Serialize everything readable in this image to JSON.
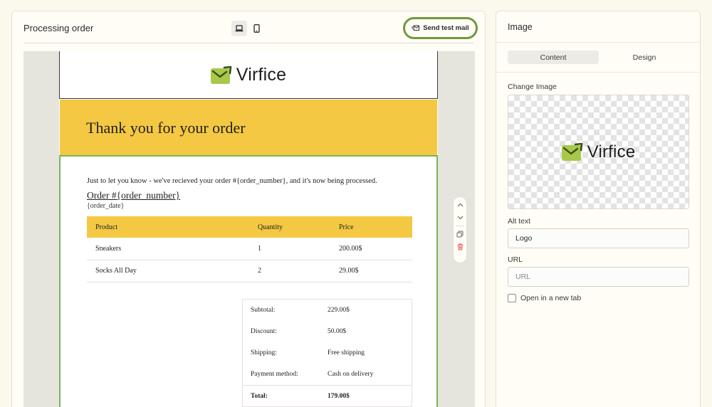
{
  "editor": {
    "title": "Processing order",
    "send_test_label": "Send test mail",
    "device_desktop_icon": "laptop-icon",
    "device_mobile_icon": "phone-icon"
  },
  "email": {
    "brand": "Virfice",
    "hero_title": "Thank you for your order",
    "intro": "Just to let you know - we've recieved your order #{order_number}, and it's now being processed.",
    "order_link": "Order #{order_number}",
    "order_date": "{order_date}",
    "items_headers": [
      "Product",
      "Quantity",
      "Price"
    ],
    "items": [
      [
        "Sneakers",
        "1",
        "200.00$"
      ],
      [
        "Socks All Day",
        "2",
        "29.00$"
      ]
    ],
    "totals": [
      {
        "label": "Subtotal:",
        "value": "229.00$"
      },
      {
        "label": "Discount:",
        "value": "50.00$"
      },
      {
        "label": "Shipping:",
        "value": "Free shipping"
      },
      {
        "label": "Payment method:",
        "value": "Cash on delivery"
      },
      {
        "label": "Total:",
        "value": "179.00$"
      }
    ]
  },
  "panel": {
    "title": "Image",
    "tabs": [
      "Content",
      "Design"
    ],
    "change_image_label": "Change Image",
    "alt_text_label": "Alt text",
    "alt_text_value": "Logo",
    "url_label": "URL",
    "url_placeholder": "URL",
    "open_new_tab_label": "Open in a new tab"
  },
  "colors": {
    "accent_green": "#6f9a3a",
    "hero_yellow": "#f5c843",
    "selection_green": "#77b55a",
    "logo_green": "#a8c84a"
  }
}
